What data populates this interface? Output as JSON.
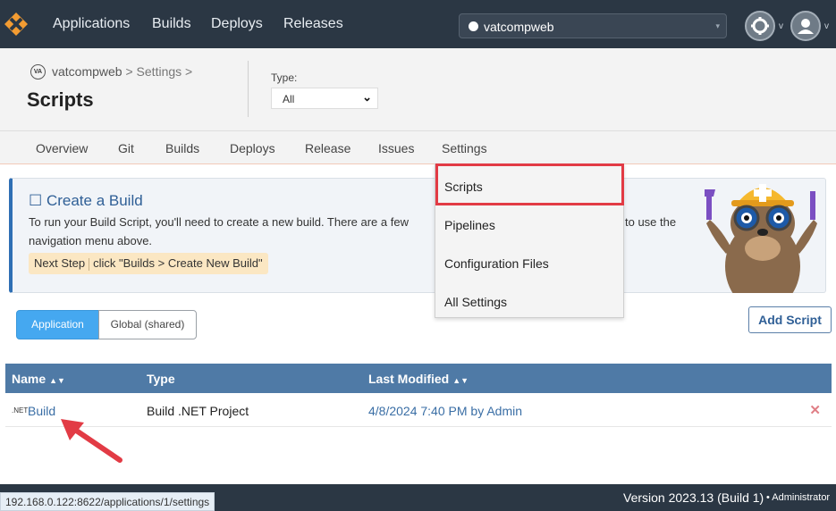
{
  "nav": {
    "items": [
      "Applications",
      "Builds",
      "Deploys",
      "Releases"
    ],
    "app_selector": "vatcompweb",
    "caret": "▾",
    "settings_icon": "gear-icon",
    "user_icon": "user-icon",
    "menu_caret": "v"
  },
  "header": {
    "app_badge": "VA",
    "breadcrumb_app": "vatcompweb",
    "breadcrumb_rest": " > Settings >",
    "title": "Scripts",
    "type_label": "Type:",
    "type_value": "All",
    "type_caret": "⌄"
  },
  "tabs": [
    "Overview",
    "Git",
    "Builds",
    "Deploys",
    "Release",
    "Issues",
    "Settings"
  ],
  "settings_menu": [
    "Scripts",
    "Pipelines",
    "Configuration Files",
    "All Settings"
  ],
  "banner": {
    "title": "☐ Create a Build",
    "text_left": "To run your Build Script, you'll need to create a new build. There are a few",
    "text_right": "to use the",
    "text_line2": "navigation menu above.",
    "next_step_label": "Next Step",
    "next_step_text": "click \"Builds > Create New Build\""
  },
  "scope": {
    "application": "Application",
    "global": "Global (shared)"
  },
  "add_script": "Add Script",
  "table": {
    "headers": [
      "Name",
      "Type",
      "Last Modified"
    ],
    "sort_glyph": "▲▼",
    "rows": [
      {
        "badge": ".NET",
        "name": "Build",
        "type": "Build .NET Project",
        "modified": "4/8/2024 7:40 PM by Admin",
        "delete": "✕"
      }
    ]
  },
  "footer": {
    "status_url": "192.168.0.122:8622/applications/1/settings",
    "version": "Version 2023.13 (Build 1)",
    "role": "• Administrator"
  },
  "colors": {
    "topbar": "#2b3744",
    "table_header": "#4f7aa6",
    "highlight": "#e23b45",
    "accent": "#45a8f0"
  }
}
